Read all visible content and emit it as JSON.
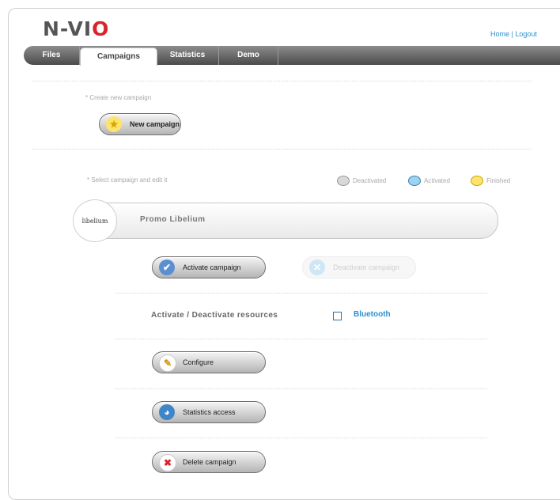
{
  "logo": {
    "prefix": "N-VI",
    "accent": "O"
  },
  "toplinks": {
    "home": "Home",
    "separator": "|",
    "logout": "Logout"
  },
  "nav": {
    "tabs": [
      "Files",
      "Campaigns",
      "Statistics",
      "Demo"
    ],
    "active": "Campaigns"
  },
  "create_section": {
    "hint": "* Create new campaign",
    "new_button": "New campaign"
  },
  "select_section": {
    "hint": "* Select campaign and edit it",
    "legend": [
      "Deactivated",
      "Activated",
      "Finished"
    ]
  },
  "campaign": {
    "name": "Promo Libelium",
    "logo_text": "libelium"
  },
  "actions": {
    "activate": "Activate campaign",
    "deactivate": "Deactivate campaign",
    "resources_label": "Activate / Deactivate resources",
    "resource_bluetooth": "Bluetooth",
    "configure": "Configure",
    "statistics": "Statistics access",
    "delete": "Delete campaign"
  },
  "colors": {
    "accent_blue": "#2a8fcf",
    "logo_red": "#d6262b",
    "legend_deactivated": "#d8d8d8",
    "legend_activated": "#9fd3f2",
    "legend_finished": "#ffe36b"
  }
}
